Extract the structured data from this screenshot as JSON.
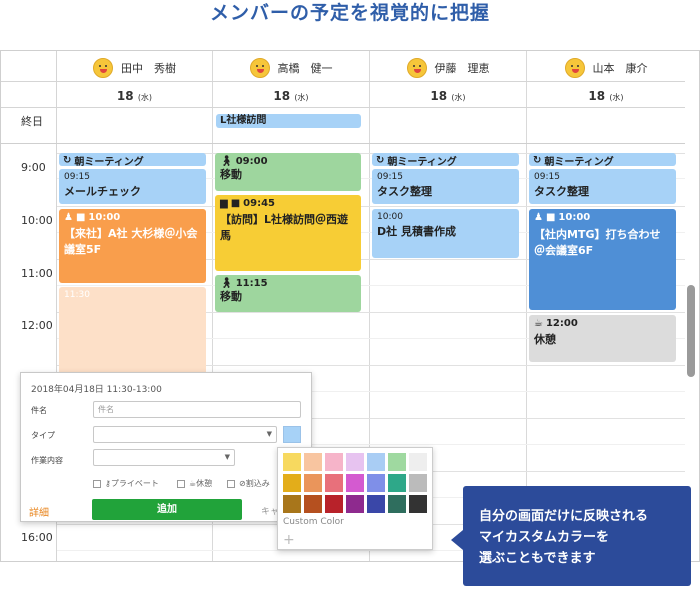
{
  "headline": "メンバーの予定を視覚的に把握",
  "members": [
    {
      "name": "田中　秀樹"
    },
    {
      "name": "高橋　健一"
    },
    {
      "name": "伊藤　理恵"
    },
    {
      "name": "山本　康介"
    }
  ],
  "date_label": {
    "day": "18",
    "weekday": "(水)"
  },
  "allday_label": "終日",
  "allday_event": "L社様訪問",
  "hours": [
    "9:00",
    "10:00",
    "11:00",
    "12:00",
    "16:00"
  ],
  "events": {
    "col1": [
      {
        "head": "朝ミーティング"
      },
      {
        "time": "09:15",
        "title": "メールチェック"
      },
      {
        "time": "10:00",
        "title": "【来社】A社 大杉様＠小会議室5F"
      },
      {
        "time": "11:30"
      }
    ],
    "col2": [
      {
        "time": "09:00",
        "title": "移動"
      },
      {
        "time": "09:45",
        "title": "【訪問】L社様訪問＠西遊馬"
      },
      {
        "time": "11:15",
        "title": "移動"
      }
    ],
    "col3": [
      {
        "head": "朝ミーティング"
      },
      {
        "time": "09:15",
        "title": "タスク整理"
      },
      {
        "time": "10:00",
        "title": "D社 見積書作成"
      }
    ],
    "col4": [
      {
        "head": "朝ミーティング"
      },
      {
        "time": "09:15",
        "title": "タスク整理"
      },
      {
        "time": "10:00",
        "title": "【社内MTG】打ち合わせ＠会議室6F"
      },
      {
        "time": "12:00",
        "title": "休憩"
      }
    ]
  },
  "popup": {
    "date": "2018年04月18日 11:30-13:00",
    "subject_label": "件名",
    "subject_placeholder": "件名",
    "type_label": "タイプ",
    "work_label": "作業内容",
    "check_private": "プライベート",
    "check_break": "休憩",
    "check_interrupt": "割込み",
    "detail": "詳細",
    "add": "追加",
    "cancel": "キャ"
  },
  "palette": {
    "label": "Custom Color",
    "plus": "+",
    "colors": [
      "#f7d95f",
      "#f8c5a0",
      "#f6b4c9",
      "#e7c3f0",
      "#a9cdf4",
      "#9fd9a0",
      "#eeeeee",
      "#e3ad1a",
      "#ea955b",
      "#e8707b",
      "#d45ad0",
      "#7f8fe8",
      "#2ea889",
      "#bbbbbb",
      "#a8761b",
      "#b5501f",
      "#b8222a",
      "#8e2a8e",
      "#3a47a8",
      "#2f6e5e",
      "#333333"
    ]
  },
  "tip": "自分の画面だけに反映される\nマイカスタムカラーを\n選ぶこともできます"
}
